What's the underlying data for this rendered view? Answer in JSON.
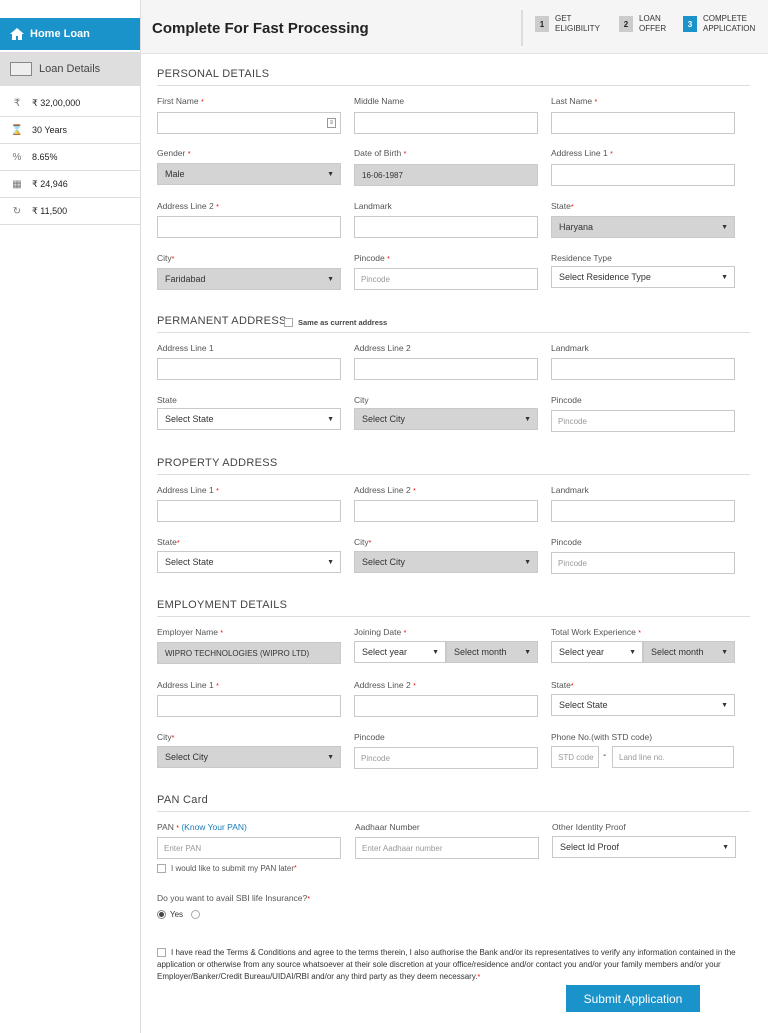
{
  "sidebar": {
    "home_loan": "Home Loan",
    "loan_details": "Loan Details",
    "items": [
      {
        "icon": "rupee-circle-icon",
        "glyph": "₹",
        "value": "₹ 32,00,000"
      },
      {
        "icon": "hourglass-icon",
        "glyph": "⌛",
        "value": "30 Years"
      },
      {
        "icon": "percent-icon",
        "glyph": "%",
        "value": "8.65%"
      },
      {
        "icon": "calculator-icon",
        "glyph": "▦",
        "value": "₹ 24,946"
      },
      {
        "icon": "refresh-cycle-icon",
        "glyph": "↻",
        "value": "₹ 11,500"
      }
    ]
  },
  "header": {
    "title": "Complete For Fast Processing",
    "steps": [
      {
        "num": "1",
        "line1": "GET",
        "line2": "ELIGIBILITY"
      },
      {
        "num": "2",
        "line1": "LOAN",
        "line2": "OFFER"
      },
      {
        "num": "3",
        "line1": "COMPLETE",
        "line2": "APPLICATION"
      }
    ]
  },
  "personal": {
    "heading": "PERSONAL DETAILS",
    "first_name_label": "First Name",
    "middle_name_label": "Middle Name",
    "last_name_label": "Last Name",
    "gender_label": "Gender",
    "gender_value": "Male",
    "dob_label": "Date of Birth",
    "dob_value": "16-06-1987",
    "addr1_label": "Address Line 1",
    "addr2_label": "Address Line 2",
    "landmark_label": "Landmark",
    "state_label": "State",
    "state_value": "Haryana",
    "city_label": "City",
    "city_value": "Faridabad",
    "pincode_label": "Pincode",
    "pincode_placeholder": "Pincode",
    "residence_label": "Residence Type",
    "residence_value": "Select Residence Type"
  },
  "permanent": {
    "heading": "PERMANENT ADDRESS",
    "same_as": "Same as current address",
    "addr1_label": "Address Line 1",
    "addr2_label": "Address Line 2",
    "landmark_label": "Landmark",
    "state_label": "State",
    "state_value": "Select State",
    "city_label": "City",
    "city_value": "Select City",
    "pincode_label": "Pincode",
    "pincode_placeholder": "Pincode"
  },
  "property": {
    "heading": "PROPERTY ADDRESS",
    "addr1_label": "Address Line 1",
    "addr2_label": "Address Line 2",
    "landmark_label": "Landmark",
    "state_label": "State",
    "state_value": "Select State",
    "city_label": "City",
    "city_value": "Select City",
    "pincode_label": "Pincode",
    "pincode_placeholder": "Pincode"
  },
  "employment": {
    "heading": "EMPLOYMENT DETAILS",
    "employer_label": "Employer Name",
    "employer_value": "WIPRO TECHNOLOGIES (WIPRO LTD)",
    "joining_label": "Joining Date",
    "select_year": "Select year",
    "select_month": "Select month",
    "experience_label": "Total Work Experience",
    "addr1_label": "Address Line 1",
    "addr2_label": "Address Line 2",
    "state_label": "State",
    "state_value": "Select State",
    "city_label": "City",
    "city_value": "Select City",
    "pincode_label": "Pincode",
    "pincode_placeholder": "Pincode",
    "phone_label": "Phone No.(with STD code)",
    "std_placeholder": "STD code",
    "dash": "-",
    "landline_placeholder": "Land line no."
  },
  "pan": {
    "heading": "PAN Card",
    "pan_label": "PAN",
    "know_pan": "(Know Your PAN)",
    "pan_placeholder": "Enter PAN",
    "aadhaar_label": "Aadhaar Number",
    "aadhaar_placeholder": "Enter Aadhaar number",
    "other_id_label": "Other Identity Proof",
    "other_id_value": "Select Id Proof",
    "submit_later": "I would like to submit my PAN later"
  },
  "insurance": {
    "question": "Do you want to avail SBI life Insurance?",
    "yes": "Yes"
  },
  "terms_text": "I have read the Terms & Conditions and agree to the terms therein, I also authorise the Bank and/or its representatives to verify any information contained in the application or otherwise from any source whatsoever at their sole discretion at your office/residence and/or contact you and/or your family members and/or your Employer/Banker/Credit Bureau/UIDAI/RBI and/or any third party as they deem necessary.",
  "submit_label": "Submit Application"
}
